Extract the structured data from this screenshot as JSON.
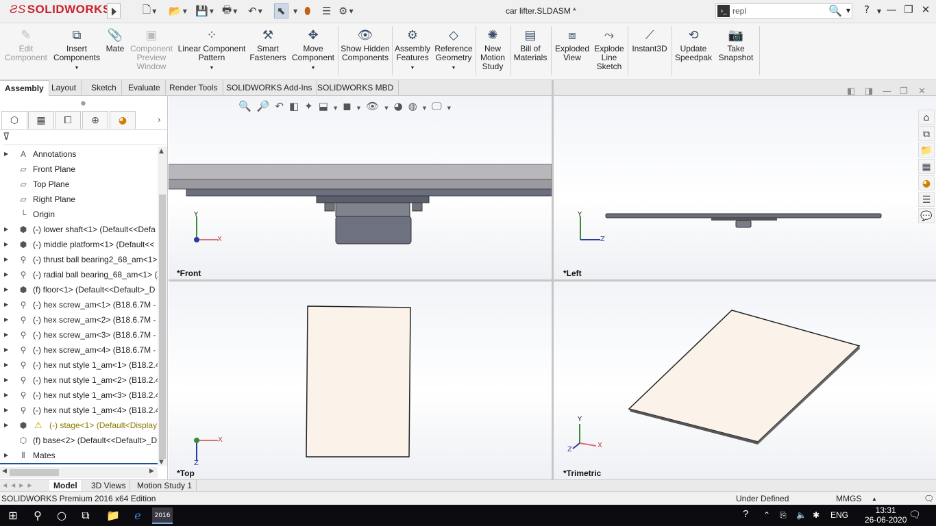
{
  "app": {
    "brand": "SOLIDWORKS",
    "document_title": "car lifter.SLDASM *",
    "search_value": "repl",
    "brand_color": "#c8202c"
  },
  "ribbon": {
    "buttons": [
      {
        "label": "Edit Component",
        "icon": "edit-component-icon",
        "disabled": true
      },
      {
        "label": "Insert Components",
        "icon": "insert-components-icon"
      },
      {
        "label": "Mate",
        "icon": "mate-icon"
      },
      {
        "label": "Component Preview Window",
        "icon": "component-preview-icon",
        "disabled": true
      },
      {
        "label": "Linear Component Pattern",
        "icon": "linear-pattern-icon"
      },
      {
        "label": "Smart Fasteners",
        "icon": "smart-fasteners-icon"
      },
      {
        "label": "Move Component",
        "icon": "move-component-icon"
      },
      {
        "label": "Show Hidden Components",
        "icon": "show-hidden-icon"
      },
      {
        "label": "Assembly Features",
        "icon": "assembly-features-icon"
      },
      {
        "label": "Reference Geometry",
        "icon": "reference-geometry-icon"
      },
      {
        "label": "New Motion Study",
        "icon": "motion-study-icon"
      },
      {
        "label": "Bill of Materials",
        "icon": "bom-icon"
      },
      {
        "label": "Exploded View",
        "icon": "exploded-view-icon"
      },
      {
        "label": "Explode Line Sketch",
        "icon": "explode-line-icon"
      },
      {
        "label": "Instant3D",
        "icon": "instant3d-icon"
      },
      {
        "label": "Update Speedpak",
        "icon": "speedpak-icon"
      },
      {
        "label": "Take Snapshot",
        "icon": "snapshot-icon"
      }
    ]
  },
  "command_tabs": [
    "Assembly",
    "Layout",
    "Sketch",
    "Evaluate",
    "Render Tools",
    "SOLIDWORKS Add-Ins",
    "SOLIDWORKS MBD"
  ],
  "tree": {
    "items": [
      {
        "label": "Annotations",
        "icon": "annotations-icon",
        "expandable": true
      },
      {
        "label": "Front Plane",
        "icon": "plane-icon"
      },
      {
        "label": "Top Plane",
        "icon": "plane-icon"
      },
      {
        "label": "Right Plane",
        "icon": "plane-icon"
      },
      {
        "label": "Origin",
        "icon": "origin-icon"
      },
      {
        "label": "(-) lower shaft<1> (Default<<Defa",
        "icon": "assembly-icon",
        "expandable": true
      },
      {
        "label": "(-) middle platform<1> (Default<<",
        "icon": "assembly-icon",
        "expandable": true
      },
      {
        "label": "(-) thrust ball bearing2_68_am<1>",
        "icon": "part-icon",
        "expandable": true
      },
      {
        "label": "(-) radial ball bearing_68_am<1> (/",
        "icon": "part-icon",
        "expandable": true
      },
      {
        "label": "(f) floor<1> (Default<<Default>_D",
        "icon": "assembly-icon",
        "expandable": true
      },
      {
        "label": "(-) hex screw_am<1> (B18.6.7M - M",
        "icon": "part-icon",
        "expandable": true
      },
      {
        "label": "(-) hex screw_am<2> (B18.6.7M - M",
        "icon": "part-icon",
        "expandable": true
      },
      {
        "label": "(-) hex screw_am<3> (B18.6.7M - M",
        "icon": "part-icon",
        "expandable": true
      },
      {
        "label": "(-) hex screw_am<4> (B18.6.7M - M",
        "icon": "part-icon",
        "expandable": true
      },
      {
        "label": "(-) hex nut style 1_am<1> (B18.2.4",
        "icon": "part-icon",
        "expandable": true
      },
      {
        "label": "(-) hex nut style 1_am<2> (B18.2.4",
        "icon": "part-icon",
        "expandable": true
      },
      {
        "label": "(-) hex nut style 1_am<3> (B18.2.4",
        "icon": "part-icon",
        "expandable": true
      },
      {
        "label": "(-) hex nut style 1_am<4> (B18.2.4",
        "icon": "part-icon",
        "expandable": true
      },
      {
        "label": "(-) stage<1> (Default<Display",
        "icon": "assembly-icon",
        "expandable": true,
        "warning": true
      },
      {
        "label": "(f) base<2> (Default<<Default>_D",
        "icon": "assembly-icon"
      },
      {
        "label": "Mates",
        "icon": "mates-icon",
        "expandable": true
      }
    ]
  },
  "viewports": {
    "front": "*Front",
    "left": "*Left",
    "top": "*Top",
    "trimetric": "*Trimetric",
    "axes": {
      "x": "X",
      "y": "Y",
      "z": "Z"
    }
  },
  "bottom_tabs": [
    "Model",
    "3D Views",
    "Motion Study 1"
  ],
  "status": {
    "edition": "SOLIDWORKS Premium 2016 x64 Edition",
    "state": "Under Defined",
    "units": "MMGS"
  },
  "taskbar": {
    "language": "ENG",
    "time": "13:31",
    "date": "26-06-2020",
    "app_badge": "2016"
  }
}
